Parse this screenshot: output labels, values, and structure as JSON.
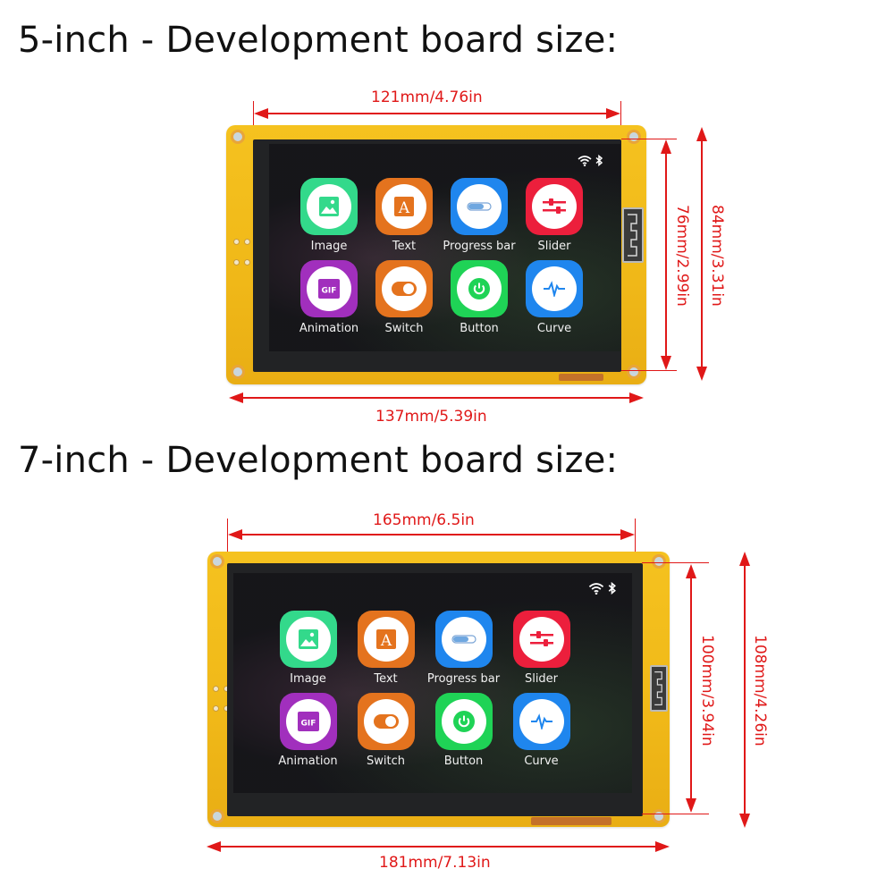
{
  "sections": [
    {
      "title": "5-inch - Development board size:",
      "dims": {
        "screen_width": "121mm/4.76in",
        "board_width": "137mm/5.39in",
        "screen_height": "76mm/2.99in",
        "board_height": "84mm/3.31in"
      }
    },
    {
      "title": "7-inch - Development board size:",
      "dims": {
        "screen_width": "165mm/6.5in",
        "board_width": "181mm/7.13in",
        "screen_height": "100mm/3.94in",
        "board_height": "108mm/4.26in"
      }
    }
  ],
  "screen_ui": {
    "status_icons": [
      "wifi-icon",
      "bluetooth-icon"
    ],
    "apps": [
      {
        "label": "Image",
        "icon": "image-icon",
        "color": "#33d98b"
      },
      {
        "label": "Text",
        "icon": "text-icon",
        "color": "#e4731e"
      },
      {
        "label": "Progress bar",
        "icon": "progress-bar-icon",
        "color": "#1f86ee"
      },
      {
        "label": "Slider",
        "icon": "slider-icon",
        "color": "#ec1f3c"
      },
      {
        "label": "Animation",
        "icon": "gif-icon",
        "color": "#a12fbd"
      },
      {
        "label": "Switch",
        "icon": "switch-icon",
        "color": "#e4731e"
      },
      {
        "label": "Button",
        "icon": "power-icon",
        "color": "#1fd356"
      },
      {
        "label": "Curve",
        "icon": "curve-icon",
        "color": "#1f86ee"
      }
    ]
  },
  "colors": {
    "dimension": "#e01818",
    "board": "#f2bd1c"
  }
}
